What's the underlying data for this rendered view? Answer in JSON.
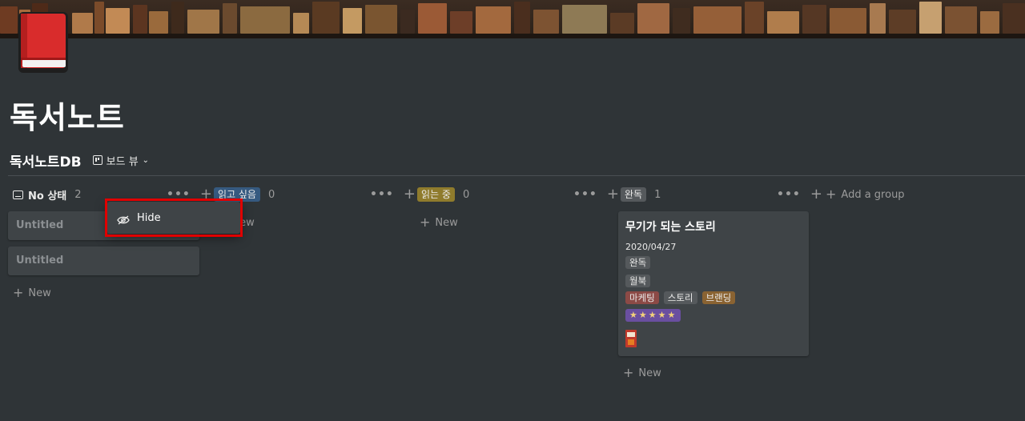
{
  "page": {
    "title": "독서노트",
    "icon_name": "red-book-icon"
  },
  "database": {
    "title": "독서노트DB",
    "view_label": "보드 뷰"
  },
  "columns": [
    {
      "label": "No 상태",
      "count": "2",
      "tag_color": null
    },
    {
      "label": "읽고 싶음",
      "count": "0",
      "tag_color": "#365a80"
    },
    {
      "label": "읽는 중",
      "count": "0",
      "tag_color": "#8f7b2c"
    },
    {
      "label": "완독",
      "count": "1",
      "tag_color": "#55595c"
    }
  ],
  "cards": {
    "no_status": [
      "Untitled",
      "Untitled"
    ],
    "done": {
      "title": "무기가 되는 스토리",
      "date": "2020/04/27",
      "status_tag": "완독",
      "source_tag": "월북",
      "categories": [
        {
          "label": "마케팅",
          "color": "#8c4a46"
        },
        {
          "label": "스토리",
          "color": "#55595c"
        },
        {
          "label": "브랜딩",
          "color": "#8a6332"
        }
      ],
      "rating": "★★★★★",
      "rating_color": "#6a4fa0"
    }
  },
  "new_label": "New",
  "add_group_label": "Add a group",
  "popup": {
    "hide_label": "Hide",
    "highlight_color": "#e00000"
  }
}
